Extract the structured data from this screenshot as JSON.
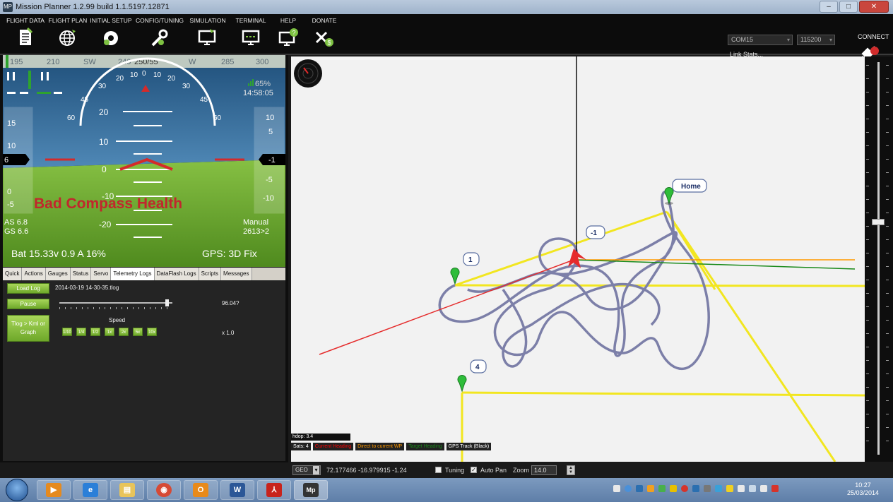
{
  "window": {
    "title": "Mission Planner 1.2.99 build 1.1.5197.12871",
    "buttons": {
      "minimize": "–",
      "maximize": "□",
      "close": "✕"
    }
  },
  "menu": [
    {
      "label": "FLIGHT DATA",
      "icon": "flight-data-icon"
    },
    {
      "label": "FLIGHT PLAN",
      "icon": "globe-icon"
    },
    {
      "label": "INITIAL SETUP",
      "icon": "setup-icon"
    },
    {
      "label": "CONFIG/TUNING",
      "icon": "wrench-icon"
    },
    {
      "label": "SIMULATION",
      "icon": "simulation-icon"
    },
    {
      "label": "TERMINAL",
      "icon": "terminal-icon"
    },
    {
      "label": "HELP",
      "icon": "help-icon"
    },
    {
      "label": "DONATE",
      "icon": "donate-icon"
    }
  ],
  "connection": {
    "port": "COM15",
    "baud": "115200",
    "link_stats": "Link Stats...",
    "connect_label": "CONNECT"
  },
  "hud": {
    "heading_tape": [
      "195",
      "210",
      "SW",
      "240",
      "250/55",
      "W",
      "285",
      "300"
    ],
    "roll_scale": [
      "30",
      "20",
      "10",
      "0",
      "10",
      "20",
      "30",
      "45",
      "45",
      "60",
      "60"
    ],
    "pitch_labels": [
      "20",
      "10",
      "0",
      "-10",
      "-20"
    ],
    "speed_tape": [
      "15",
      "10",
      "6",
      "0",
      "-5"
    ],
    "alt_tape": [
      "10",
      "5",
      "-1",
      "-5",
      "-10"
    ],
    "signal": "65%",
    "time": "14:58:05",
    "warning": "Bad Compass Health",
    "airspeed": "AS 6.8",
    "groundspeed": "GS 6.6",
    "mode": "Manual",
    "wp": "2613>2",
    "battery": "Bat 15.33v 0.9 A 16%",
    "gps": "GPS: 3D Fix",
    "colors": {
      "sky": "#2e5d86",
      "ground": "#6aa231",
      "warning": "#c1272d"
    }
  },
  "tabs": [
    {
      "label": "Quick",
      "active": false
    },
    {
      "label": "Actions",
      "active": false
    },
    {
      "label": "Gauges",
      "active": false
    },
    {
      "label": "Status",
      "active": false
    },
    {
      "label": "Servo",
      "active": false
    },
    {
      "label": "Telemetry Logs",
      "active": true
    },
    {
      "label": "DataFlash Logs",
      "active": false
    },
    {
      "label": "Scripts",
      "active": false
    },
    {
      "label": "Messages",
      "active": false
    }
  ],
  "telemetry_logs": {
    "load_log": "Load Log",
    "filename": "2014-03-19 14-30-35.tlog",
    "pause": "Pause",
    "tlog_kml": "Tlog > Kml or Graph",
    "speed_label": "Speed",
    "speed_buttons": [
      "1/10",
      "1/4",
      "1/2",
      "1x",
      "2x",
      "5x",
      "10x"
    ],
    "position_value": "96.04?",
    "speed_value": "x 1.0",
    "slider_fraction": 0.97
  },
  "map": {
    "markers": [
      {
        "label": "Home"
      },
      {
        "label": "1"
      },
      {
        "label": "-1"
      },
      {
        "label": "4"
      }
    ],
    "hdop": "hdop: 3.4",
    "sats": "Sats: 4",
    "legend": [
      {
        "label": "Current Heading",
        "color": "#ff0000"
      },
      {
        "label": "Direct to current WP",
        "color": "#ff9900"
      },
      {
        "label": "Target Heading",
        "color": "#1a8a1a"
      },
      {
        "label": "GPS Track (Black)",
        "color": "#ffffff"
      }
    ]
  },
  "bottom": {
    "mode": "GEO",
    "coords": "72.177466 -16.979915 -1.24",
    "tuning": "Tuning",
    "auto_pan": "Auto Pan",
    "zoom_label": "Zoom",
    "zoom_value": "14.0"
  },
  "taskbar": {
    "apps": [
      "start-orb",
      "media-player",
      "internet-explorer",
      "file-explorer",
      "chrome",
      "outlook",
      "word",
      "acrobat",
      "mission-planner"
    ],
    "time": "10:27",
    "date": "25/03/2014"
  }
}
